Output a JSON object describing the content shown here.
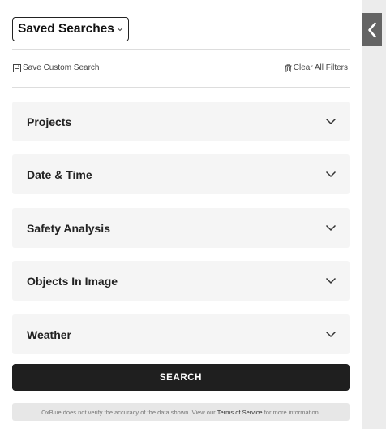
{
  "saved_searches": {
    "label": "Saved Searches"
  },
  "actions": {
    "save_custom_search": "Save Custom Search",
    "clear_all_filters": "Clear All Filters"
  },
  "filters": [
    {
      "title": "Projects"
    },
    {
      "title": "Date & Time"
    },
    {
      "title": "Safety Analysis"
    },
    {
      "title": "Objects In Image"
    },
    {
      "title": "Weather"
    }
  ],
  "search_button": {
    "label": "SEARCH"
  },
  "disclaimer": {
    "prefix": "OxBlue does not verify the accuracy of the data shown. View our ",
    "link": "Terms of Service",
    "suffix": " for more information."
  },
  "icons": {
    "collapse": "chevron-left-icon",
    "saved_dropdown": "chevron-down-icon",
    "save": "floppy-disk-icon",
    "clear": "trash-icon",
    "expand": "chevron-down-icon"
  },
  "colors": {
    "accordion_bg": "#f5f5f5",
    "search_button_bg": "#1f1f1f",
    "collapse_tab_bg": "#646464",
    "rail_bg": "#ececec"
  }
}
